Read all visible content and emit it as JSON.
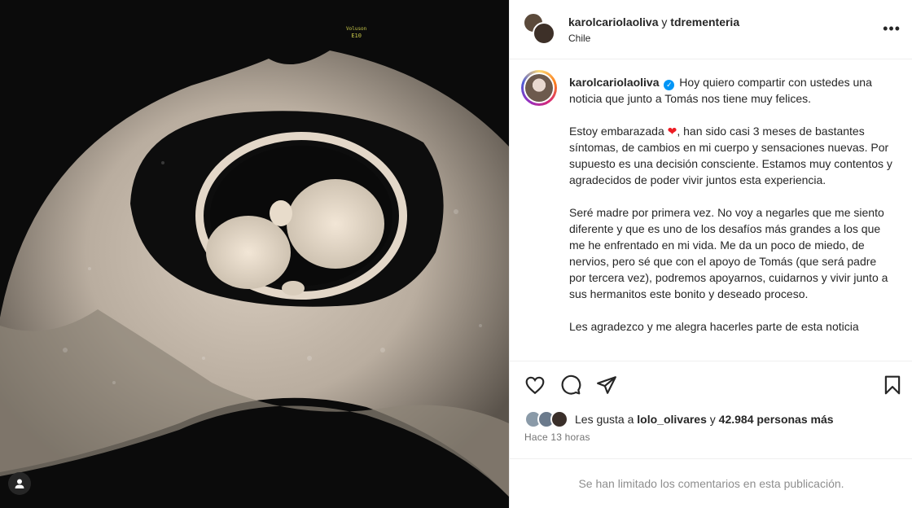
{
  "header": {
    "author_primary": "karolcariolaoliva",
    "joiner": "y",
    "author_secondary": "tdrementeria",
    "location": "Chile",
    "more_icon": "more-horizontal-icon"
  },
  "media": {
    "scan_label_line1": "Voluson",
    "scan_label_line2": "E10",
    "tag_icon": "user-tag-icon"
  },
  "caption": {
    "username": "karolcariolaoliva",
    "verified_icon": "verified-badge-icon",
    "p1": "Hoy quiero compartir con ustedes una noticia que junto a Tomás nos tiene muy felices.",
    "p2_before": "Estoy embarazada",
    "p2_heart": "❤",
    "p2_after": ", han sido casi 3 meses de bastantes síntomas, de cambios en mi cuerpo y sensaciones nuevas. Por supuesto es una decisión consciente. Estamos muy contentos y agradecidos de poder vivir juntos esta experiencia.",
    "p3": "Seré madre por primera vez. No voy a negarles que me siento diferente y que es uno de los desafíos más grandes a los que me he enfrentado en mi vida. Me da un poco de miedo, de nervios, pero sé que con el apoyo de Tomás (que será padre por tercera vez), podremos apoyarnos, cuidarnos y vivir junto a sus hermanitos este bonito y deseado proceso.",
    "p4": "Les agradezco y me alegra hacerles parte de esta noticia"
  },
  "actions": {
    "like_icon": "heart-icon",
    "comment_icon": "comment-icon",
    "share_icon": "send-icon",
    "save_icon": "bookmark-icon"
  },
  "likes": {
    "prefix": "Les gusta a",
    "user": "lolo_olivares",
    "joiner": "y",
    "count": "42.984 personas más"
  },
  "time": "Hace 13 horas",
  "comments_notice": "Se han limitado los comentarios en esta publicación."
}
